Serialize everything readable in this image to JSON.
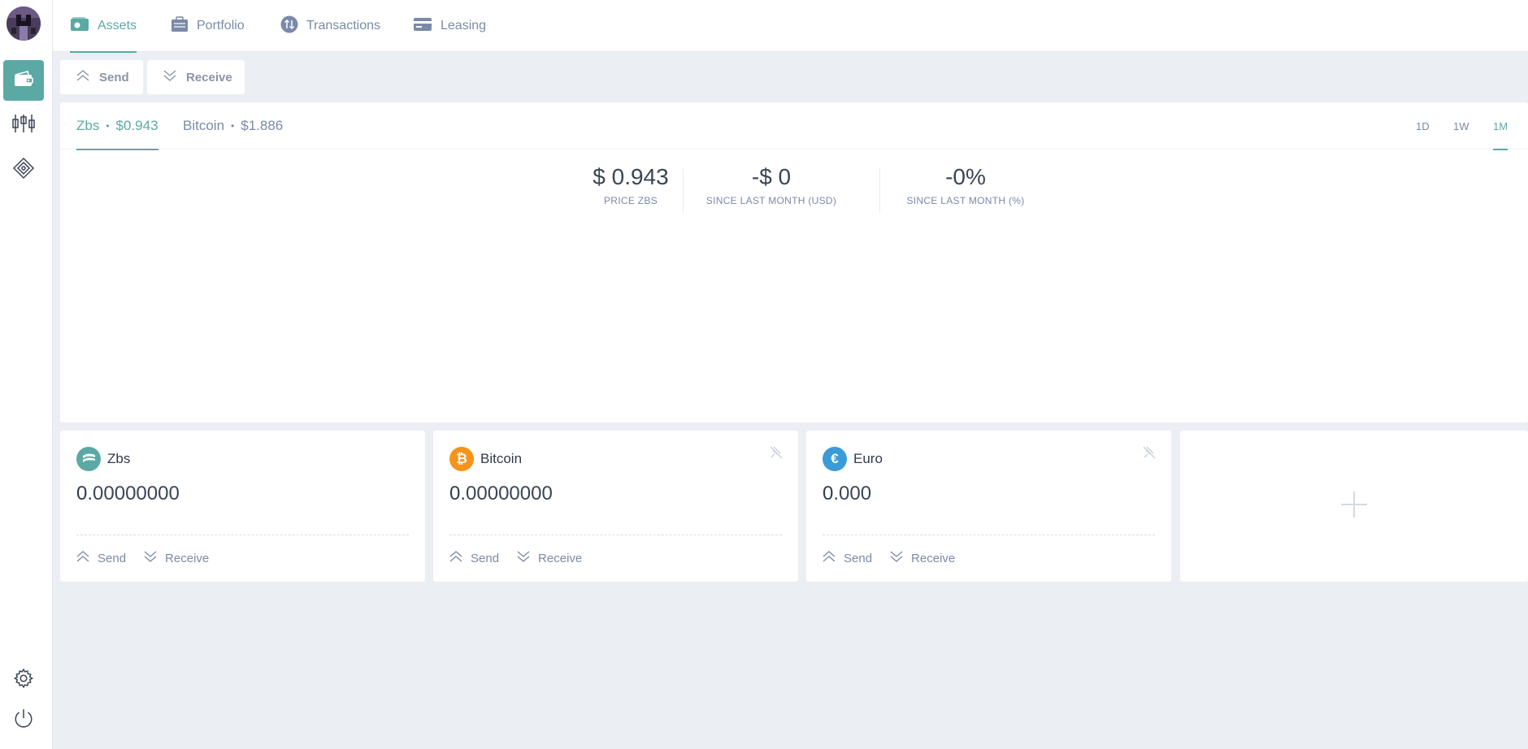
{
  "nav": {
    "tabs": [
      {
        "label": "Assets",
        "icon": "wallet-icon"
      },
      {
        "label": "Portfolio",
        "icon": "briefcase-icon"
      },
      {
        "label": "Transactions",
        "icon": "arrows-updown-icon"
      },
      {
        "label": "Leasing",
        "icon": "card-icon"
      }
    ]
  },
  "sidebar": {
    "items": [
      {
        "icon": "wallet-icon",
        "active": true
      },
      {
        "icon": "candlestick-icon",
        "active": false
      },
      {
        "icon": "token-icon",
        "active": false
      }
    ],
    "bottom": [
      {
        "icon": "gear-icon"
      },
      {
        "icon": "power-icon"
      }
    ]
  },
  "actions": {
    "send_label": "Send",
    "receive_label": "Receive"
  },
  "chart_panel": {
    "tabs": [
      {
        "name": "Zbs",
        "dot": "•",
        "price": "$0.943",
        "active": true
      },
      {
        "name": "Bitcoin",
        "dot": "•",
        "price": "$1.886",
        "active": false
      }
    ],
    "ranges": [
      "1D",
      "1W",
      "1M"
    ],
    "active_range": "1M",
    "stats": [
      {
        "value": "$ 0.943",
        "label": "PRICE ZBS"
      },
      {
        "value": "-$ 0",
        "label": "SINCE LAST MONTH (USD)"
      },
      {
        "value": "-0%",
        "label": "SINCE LAST MONTH (%)"
      }
    ]
  },
  "assets": [
    {
      "name": "Zbs",
      "int": "0",
      "frac": ".00000000",
      "send": "Send",
      "receive": "Receive",
      "color": "#5aa9a4",
      "icon": "zbs-coin-icon"
    },
    {
      "name": "Bitcoin",
      "int": "0",
      "frac": ".00000000",
      "send": "Send",
      "receive": "Receive",
      "color": "#f7931a",
      "icon": "bitcoin-coin-icon"
    },
    {
      "name": "Euro",
      "int": "0",
      "frac": ".000",
      "send": "Send",
      "receive": "Receive",
      "color": "#3a9bd9",
      "icon": "euro-coin-icon"
    }
  ],
  "colors": {
    "accent": "#5aa9a4",
    "muted": "#7a8aa8",
    "background": "#ebeef3"
  }
}
